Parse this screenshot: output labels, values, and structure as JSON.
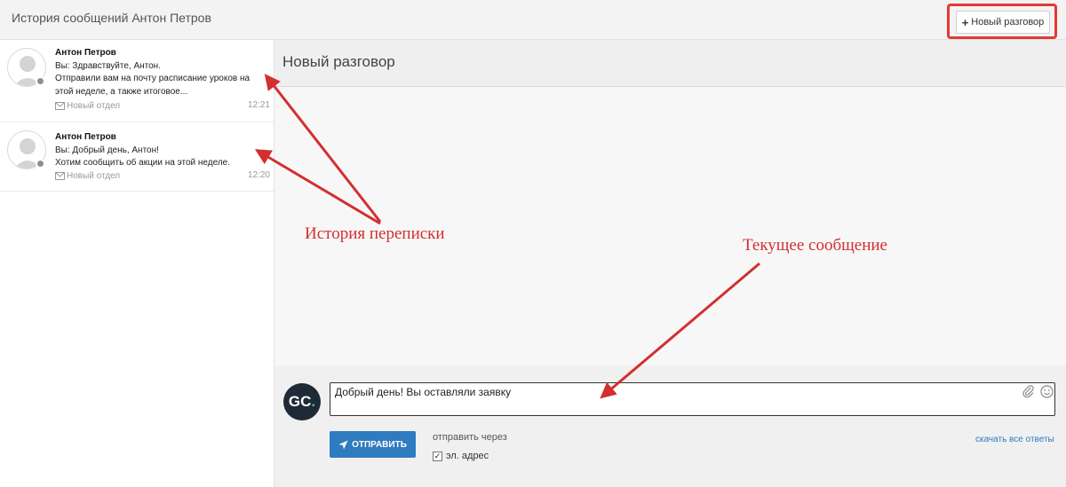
{
  "header": {
    "title": "История сообщений Антон Петров",
    "new_conversation_label": "Новый разговор"
  },
  "conversations": [
    {
      "name": "Антон Петров",
      "line1": "Вы: Здравствуйте, Антон.",
      "line2": "Отправили вам на почту расписание уроков на",
      "line3": "этой неделе, а также итоговое...",
      "department": "Новый отдел",
      "time": "12:21"
    },
    {
      "name": "Антон Петров",
      "line1": "Вы: Добрый день, Антон!",
      "line2": "Хотим сообщить об акции на этой неделе.",
      "department": "Новый отдел",
      "time": "12:20"
    }
  ],
  "main": {
    "title": "Новый разговор",
    "composer": {
      "avatar_text": "GC",
      "avatar_dot": ".",
      "message_value": "Добрый день! Вы оставляли заявку",
      "send_label": "ОТПРАВИТЬ",
      "send_via_label": "отправить через",
      "email_option_label": "эл. адрес",
      "email_checked": true,
      "download_link": "скачать все ответы"
    }
  },
  "annotations": {
    "history": "История переписки",
    "current": "Текущее сообщение"
  },
  "colors": {
    "annotation": "#d32f2f",
    "send_button": "#2f7bbf",
    "avatar_bg": "#1e2b36",
    "avatar_accent": "#29c4b8"
  },
  "icons": [
    "plus-icon",
    "user-avatar-icon",
    "envelope-icon",
    "paperclip-icon",
    "smile-icon",
    "send-icon",
    "checkbox"
  ]
}
